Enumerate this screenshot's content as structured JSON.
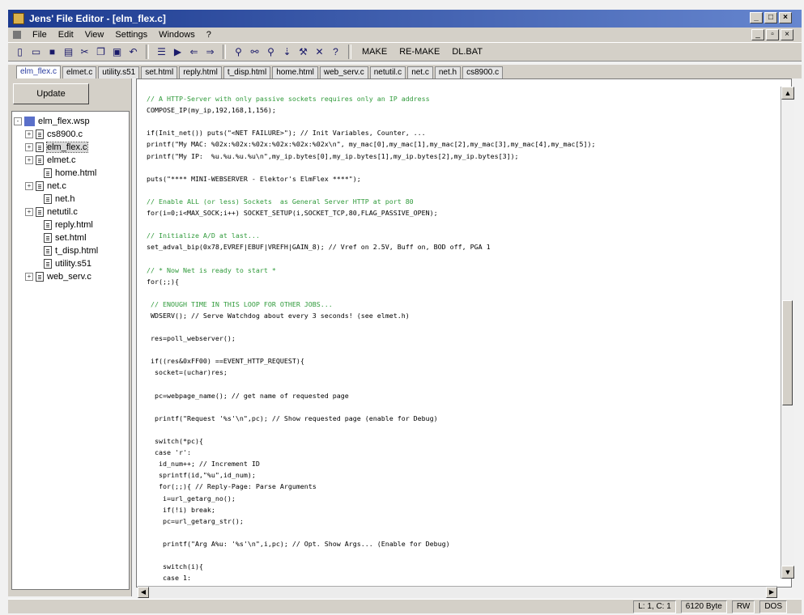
{
  "window": {
    "title": "Jens' File Editor - [elm_flex.c]"
  },
  "menu": {
    "items": [
      "File",
      "Edit",
      "View",
      "Settings",
      "Windows",
      "?"
    ]
  },
  "toolbar": {
    "make_label": "MAKE",
    "remake_label": "RE-MAKE",
    "dlbat_label": "DL.BAT"
  },
  "tabs": [
    "elm_flex.c",
    "elmet.c",
    "utility.s51",
    "set.html",
    "reply.html",
    "t_disp.html",
    "home.html",
    "web_serv.c",
    "netutil.c",
    "net.c",
    "net.h",
    "cs8900.c"
  ],
  "sidebar": {
    "update_label": "Update",
    "tree": [
      {
        "label": "elm_flex.wsp",
        "type": "project",
        "expander": "-"
      },
      {
        "label": "cs8900.c",
        "type": "file",
        "expander": "+"
      },
      {
        "label": "elm_flex.c",
        "type": "file",
        "expander": "+",
        "selected": true
      },
      {
        "label": "elmet.c",
        "type": "file",
        "expander": "+"
      },
      {
        "label": "home.html",
        "type": "file",
        "expander": ""
      },
      {
        "label": "net.c",
        "type": "file",
        "expander": "+"
      },
      {
        "label": "net.h",
        "type": "file",
        "expander": ""
      },
      {
        "label": "netutil.c",
        "type": "file",
        "expander": "+"
      },
      {
        "label": "reply.html",
        "type": "file",
        "expander": ""
      },
      {
        "label": "set.html",
        "type": "file",
        "expander": ""
      },
      {
        "label": "t_disp.html",
        "type": "file",
        "expander": ""
      },
      {
        "label": "utility.s51",
        "type": "file",
        "expander": ""
      },
      {
        "label": "web_serv.c",
        "type": "file",
        "expander": "+"
      }
    ]
  },
  "editor": {
    "lines": [
      {
        "text": "// A HTTP-Server with only passive sockets requires only an IP address",
        "type": "comment"
      },
      {
        "text": "COMPOSE_IP(my_ip,192,168,1,156);",
        "type": "code"
      },
      {
        "text": "",
        "type": "code"
      },
      {
        "text": "if(Init_net()) puts(\"<NET FAILURE>\"); // Init Variables, Counter, ...",
        "type": "code"
      },
      {
        "text": "printf(\"My MAC: %02x:%02x:%02x:%02x:%02x:%02x\\n\", my_mac[0],my_mac[1],my_mac[2],my_mac[3],my_mac[4],my_mac[5]);",
        "type": "code"
      },
      {
        "text": "printf(\"My IP:  %u.%u.%u.%u\\n\",my_ip.bytes[0],my_ip.bytes[1],my_ip.bytes[2],my_ip.bytes[3]);",
        "type": "code"
      },
      {
        "text": "",
        "type": "code"
      },
      {
        "text": "puts(\"**** MINI-WEBSERVER - Elektor's ElmFlex ****\");",
        "type": "code"
      },
      {
        "text": "",
        "type": "code"
      },
      {
        "text": "// Enable ALL (or less) Sockets  as General Server HTTP at port 80",
        "type": "comment"
      },
      {
        "text": "for(i=0;i<MAX_SOCK;i++) SOCKET_SETUP(i,SOCKET_TCP,80,FLAG_PASSIVE_OPEN);",
        "type": "code"
      },
      {
        "text": "",
        "type": "code"
      },
      {
        "text": "// Initialize A/D at last...",
        "type": "comment"
      },
      {
        "text": "set_adval_bip(0x78,EVREF|EBUF|VREFH|GAIN_8); // Vref on 2.5V, Buff on, BOD off, PGA 1",
        "type": "code"
      },
      {
        "text": "",
        "type": "code"
      },
      {
        "text": "// * Now Net is ready to start *",
        "type": "comment"
      },
      {
        "text": "for(;;){",
        "type": "code"
      },
      {
        "text": "",
        "type": "code"
      },
      {
        "text": " // ENOUGH TIME IN THIS LOOP FOR OTHER JOBS...",
        "type": "comment"
      },
      {
        "text": " WDSERV(); // Serve Watchdog about every 3 seconds! (see elmet.h)",
        "type": "code"
      },
      {
        "text": "",
        "type": "code"
      },
      {
        "text": " res=poll_webserver();",
        "type": "code"
      },
      {
        "text": "",
        "type": "code"
      },
      {
        "text": " if((res&0xFF00) ==EVENT_HTTP_REQUEST){",
        "type": "code"
      },
      {
        "text": "  socket=(uchar)res;",
        "type": "code"
      },
      {
        "text": "",
        "type": "code"
      },
      {
        "text": "  pc=webpage_name(); // get name of requested page",
        "type": "code"
      },
      {
        "text": "",
        "type": "code"
      },
      {
        "text": "  printf(\"Request '%s'\\n\",pc); // Show requested page (enable for Debug)",
        "type": "code"
      },
      {
        "text": "",
        "type": "code"
      },
      {
        "text": "  switch(*pc){",
        "type": "code"
      },
      {
        "text": "  case 'r':",
        "type": "code"
      },
      {
        "text": "   id_num++; // Increment ID",
        "type": "code"
      },
      {
        "text": "   sprintf(id,\"%u\",id_num);",
        "type": "code"
      },
      {
        "text": "   for(;;){ // Reply-Page: Parse Arguments",
        "type": "code"
      },
      {
        "text": "    i=url_getarg_no();",
        "type": "code"
      },
      {
        "text": "    if(!i) break;",
        "type": "code"
      },
      {
        "text": "    pc=url_getarg_str();",
        "type": "code"
      },
      {
        "text": "",
        "type": "code"
      },
      {
        "text": "    printf(\"Arg A%u: '%s'\\n\",i,pc); // Opt. Show Args... (Enable for Debug)",
        "type": "code"
      },
      {
        "text": "",
        "type": "code"
      },
      {
        "text": "    switch(i){",
        "type": "code"
      },
      {
        "text": "    case 1:",
        "type": "code"
      }
    ]
  },
  "status": {
    "position": "L: 1, C: 1",
    "size": "6120 Byte",
    "mode": "RW",
    "format": "DOS"
  }
}
